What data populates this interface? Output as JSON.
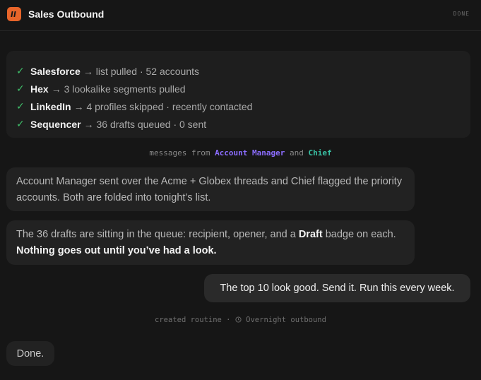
{
  "header": {
    "app_icon": "brand-logo-icon",
    "title": "Sales Outbound",
    "status": "DONE"
  },
  "steps": [
    {
      "name": "Salesforce",
      "detail": "→ list pulled · 52 accounts"
    },
    {
      "name": "Hex",
      "detail": "→ 3 lookalike segments pulled"
    },
    {
      "name": "LinkedIn",
      "detail": "→ 4 profiles skipped · recently contacted"
    },
    {
      "name": "Sequencer",
      "detail": "→ 36 drafts queued · 0 sent"
    }
  ],
  "check_glyph": "✓",
  "messages_from": {
    "prefix": "messages from",
    "agent1": "Account Manager",
    "joiner": "and",
    "agent2": "Chief"
  },
  "message1": {
    "text": "Account Manager sent over the Acme + Globex threads and Chief flagged the priority accounts. Both are folded into tonight’s list."
  },
  "message2": {
    "text_a": "The 36 drafts are sitting in the queue: recipient, opener, and a",
    "bold_a": "Draft",
    "text_b": "badge on each.",
    "bold_b": "Nothing goes out until you’ve had a look."
  },
  "user_message": "The top 10 look good. Send it. Run this every week.",
  "routine": {
    "prefix": "created routine ·",
    "icon": "clock-icon",
    "name": "Overnight outbound"
  },
  "final_message": "Done.",
  "colors": {
    "background": "#161616",
    "accent_logo": "#e8652a",
    "check": "#3fbf6a",
    "agent1": "#8b6dff",
    "agent2": "#39c2a5"
  }
}
